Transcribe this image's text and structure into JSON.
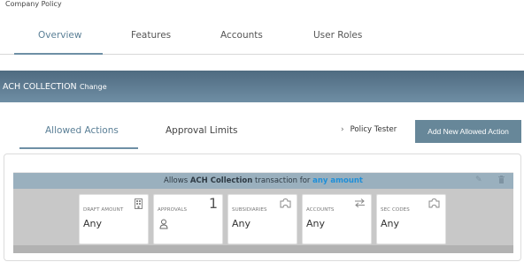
{
  "breadcrumb": "Company Policy",
  "top_tabs": [
    {
      "label": "Overview",
      "active": true
    },
    {
      "label": "Features",
      "active": false
    },
    {
      "label": "Accounts",
      "active": false
    },
    {
      "label": "User Roles",
      "active": false
    }
  ],
  "policy_bar": {
    "name": "ACH COLLECTION",
    "change_label": "Change"
  },
  "sub_tabs": [
    {
      "label": "Allowed Actions",
      "active": true
    },
    {
      "label": "Approval Limits",
      "active": false
    }
  ],
  "policy_tester": "Policy Tester",
  "add_button": "Add New Allowed Action",
  "rule": {
    "prefix": "Allows ",
    "type": "ACH Collection",
    "middle": " transaction for ",
    "amount": "any amount"
  },
  "cards": {
    "draft_amount": {
      "label": "DRAFT AMOUNT",
      "value": "Any",
      "icon": "building-icon"
    },
    "approvals": {
      "label": "APPROVALS",
      "count": "1",
      "icon": "user-icon"
    },
    "subsidiaries": {
      "label": "SUBSIDIARIES",
      "value": "Any",
      "icon": "puzzle-icon"
    },
    "accounts": {
      "label": "ACCOUNTS",
      "value": "Any",
      "icon": "transfer-icon"
    },
    "sec_codes": {
      "label": "SEC CODES",
      "value": "Any",
      "icon": "puzzle-icon"
    }
  },
  "colors": {
    "accent": "#678799",
    "bar": "#5d7a8f",
    "link": "#1f8fd8"
  }
}
